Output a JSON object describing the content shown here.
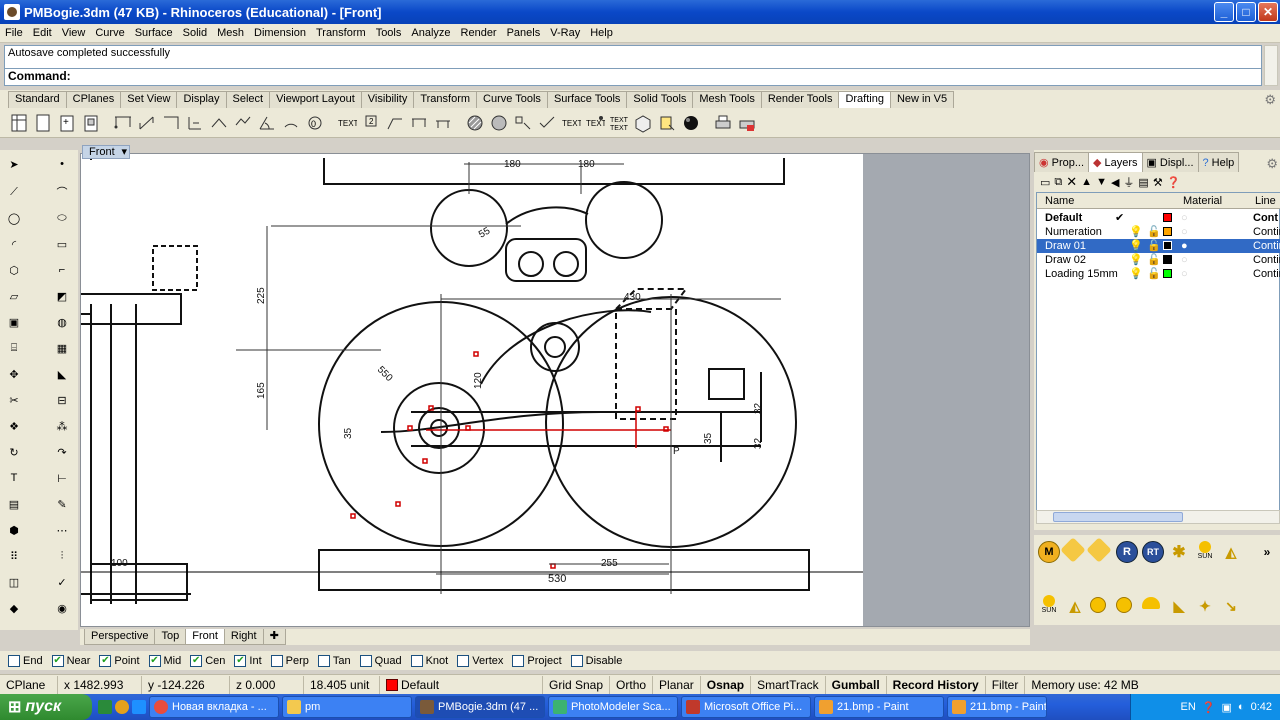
{
  "window": {
    "title": "PMBogie.3dm (47 KB) - Rhinoceros (Educational) - [Front]",
    "min": "_",
    "max": "□",
    "close": "✕"
  },
  "menu": [
    "File",
    "Edit",
    "View",
    "Curve",
    "Surface",
    "Solid",
    "Mesh",
    "Dimension",
    "Transform",
    "Tools",
    "Analyze",
    "Render",
    "Panels",
    "V-Ray",
    "Help"
  ],
  "command": {
    "history": "Autosave completed successfully",
    "prompt": "Command:"
  },
  "toolbar_tabs": [
    "Standard",
    "CPlanes",
    "Set View",
    "Display",
    "Select",
    "Viewport Layout",
    "Visibility",
    "Transform",
    "Curve Tools",
    "Surface Tools",
    "Solid Tools",
    "Mesh Tools",
    "Render Tools",
    "Drafting",
    "New in V5"
  ],
  "toolbar_active_tab": "Drafting",
  "viewport": {
    "name": "Front",
    "dims": {
      "top_left": "180",
      "top_right": "180",
      "h1": "225",
      "h2": "165",
      "d_left": "35",
      "d_mid": "120",
      "d_right": "430",
      "bottom": "530",
      "bottom_r": "255",
      "bottom_l": "100",
      "r_small": "55",
      "r_big": "550",
      "r_right1": "35",
      "r_right2": "32",
      "r_right3": "32",
      "label_p": "P"
    }
  },
  "viewport_tabs": [
    "Perspective",
    "Top",
    "Front",
    "Right"
  ],
  "viewport_tab_active": "Front",
  "right_panel": {
    "tabs": [
      "Prop...",
      "Layers",
      "Displ...",
      "Help"
    ],
    "active_tab": "Layers",
    "columns": [
      "Name",
      "Material",
      "Line"
    ],
    "layers": [
      {
        "name": "Default",
        "bold": true,
        "current": "✔",
        "color": "#ff0000",
        "line": "Cont"
      },
      {
        "name": "Numeration",
        "bold": false,
        "current": "",
        "color": "#ffa500",
        "line": "Contin"
      },
      {
        "name": "Draw 01",
        "bold": false,
        "current": "",
        "color": "#000000",
        "line": "Contin",
        "selected": true
      },
      {
        "name": "Draw 02",
        "bold": false,
        "current": "",
        "color": "#000000",
        "line": "Contin"
      },
      {
        "name": "Loading 15mm",
        "bold": false,
        "current": "",
        "color": "#00ff00",
        "line": "Contin"
      }
    ]
  },
  "render_tools": {
    "row1": [
      "M",
      "",
      "",
      "R",
      "RT",
      "",
      "SUN",
      ""
    ],
    "sun_label": "SUN"
  },
  "osnap": [
    {
      "label": "End",
      "checked": false
    },
    {
      "label": "Near",
      "checked": true
    },
    {
      "label": "Point",
      "checked": true
    },
    {
      "label": "Mid",
      "checked": true
    },
    {
      "label": "Cen",
      "checked": true
    },
    {
      "label": "Int",
      "checked": true
    },
    {
      "label": "Perp",
      "checked": false
    },
    {
      "label": "Tan",
      "checked": false
    },
    {
      "label": "Quad",
      "checked": false
    },
    {
      "label": "Knot",
      "checked": false
    },
    {
      "label": "Vertex",
      "checked": false
    },
    {
      "label": "Project",
      "checked": false
    },
    {
      "label": "Disable",
      "checked": false
    }
  ],
  "status": {
    "cplane": "CPlane",
    "x": "x 1482.993",
    "y": "y -124.226",
    "z": "z 0.000",
    "unit": "18.405 unit",
    "layer": "Default",
    "layer_color": "#ff0000",
    "grid_snap": "Grid Snap",
    "ortho": "Ortho",
    "planar": "Planar",
    "osnap": "Osnap",
    "smarttrack": "SmartTrack",
    "gumball": "Gumball",
    "record_history": "Record History",
    "filter": "Filter",
    "memory": "Memory use: 42 MB"
  },
  "taskbar": {
    "start": "пуск",
    "items": [
      {
        "label": "Новая вкладка - ...",
        "color": "#e84c3d"
      },
      {
        "label": "pm",
        "color": "#f3c94f"
      },
      {
        "label": "PMBogie.3dm (47 ...",
        "color": "#7a5a3a",
        "active": true
      },
      {
        "label": "PhotoModeler Sca...",
        "color": "#3cb371"
      },
      {
        "label": "Microsoft Office Pi...",
        "color": "#c0392b"
      },
      {
        "label": "21.bmp - Paint",
        "color": "#f0a030"
      },
      {
        "label": "211.bmp - Paint",
        "color": "#f0a030"
      }
    ],
    "lang": "EN",
    "clock": "0:42"
  }
}
